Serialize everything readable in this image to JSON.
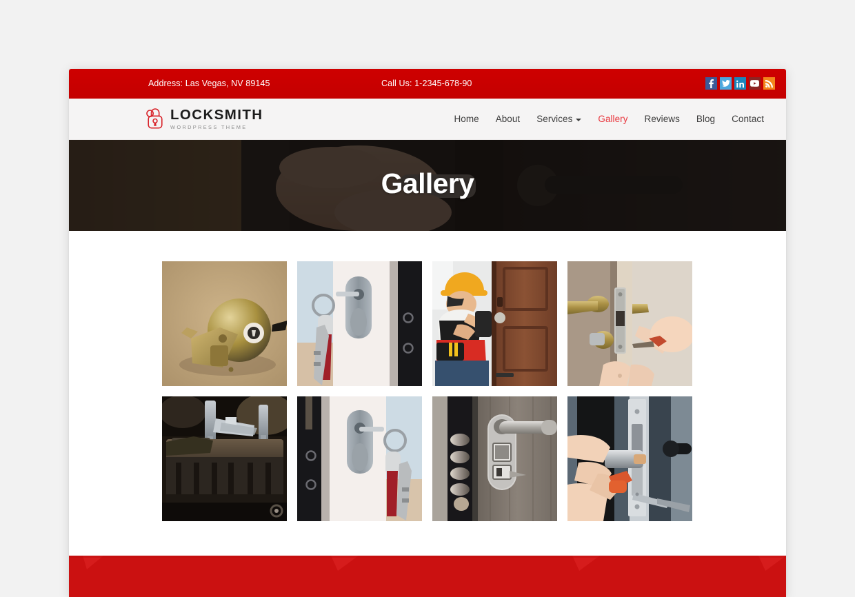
{
  "topbar": {
    "address": "Address: Las Vegas, NV 89145",
    "phone": "Call Us: 1-2345-678-90",
    "social": [
      {
        "name": "facebook-icon",
        "label": "f",
        "color": "#3b5998"
      },
      {
        "name": "twitter-icon",
        "label": "t",
        "color": "#4da7de"
      },
      {
        "name": "linkedin-icon",
        "label": "in",
        "color": "#1b86bc"
      },
      {
        "name": "youtube-icon",
        "label": "yt",
        "color": "#8b2423"
      },
      {
        "name": "rss-icon",
        "label": "rss",
        "color": "#f3861c"
      }
    ]
  },
  "header": {
    "logo_title": "LOCKSMITH",
    "logo_subtitle": "WORDPRESS THEME",
    "logo_icon": "padlock-icon",
    "nav": [
      {
        "label": "Home",
        "active": false,
        "dropdown": false
      },
      {
        "label": "About",
        "active": false,
        "dropdown": false
      },
      {
        "label": "Services",
        "active": false,
        "dropdown": true
      },
      {
        "label": "Gallery",
        "active": true,
        "dropdown": false
      },
      {
        "label": "Reviews",
        "active": false,
        "dropdown": false
      },
      {
        "label": "Blog",
        "active": false,
        "dropdown": false
      },
      {
        "label": "Contact",
        "active": false,
        "dropdown": false
      }
    ]
  },
  "hero": {
    "title": "Gallery",
    "background_description": "hands-installing-door-lock-photo"
  },
  "gallery": {
    "items": [
      {
        "caption": "brass-doorknob-with-cylinder"
      },
      {
        "caption": "keys-with-red-fob-in-door-lock"
      },
      {
        "caption": "technician-in-hard-hat-installing-wooden-door-lock"
      },
      {
        "caption": "hand-with-screwdriver-on-brass-door-handle"
      },
      {
        "caption": "key-cutting-machine-close-up"
      },
      {
        "caption": "keys-with-red-fob-in-door-lock-mirrored"
      },
      {
        "caption": "security-door-deadbolt-pins-and-lever-handle"
      },
      {
        "caption": "hands-installing-lock-cylinder-with-orange-screwdriver"
      }
    ]
  },
  "colors": {
    "brand_red": "#cc0000",
    "accent_red": "#e8363d",
    "footer_red": "#cb1111",
    "page_bg": "#f2f2f2",
    "header_bg": "#f5f4f4"
  }
}
